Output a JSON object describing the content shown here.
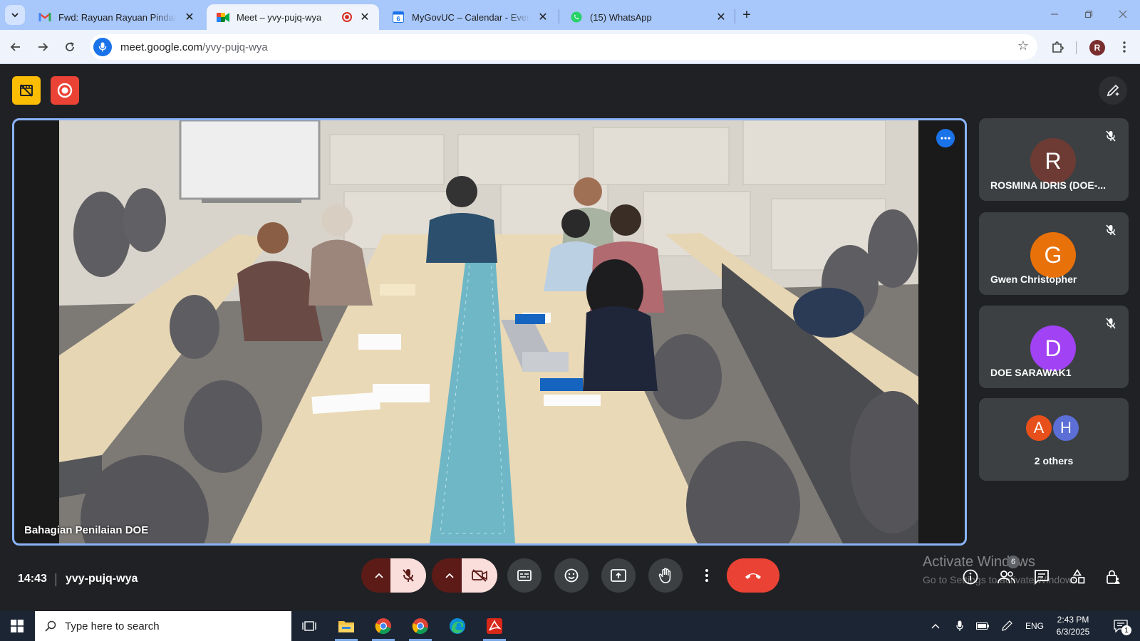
{
  "browser": {
    "tabs": [
      {
        "label": "Fwd: Rayuan Rayuan Pindaan ke",
        "icon": "gmail-icon"
      },
      {
        "label": "Meet – yvy-pujq-wya",
        "icon": "meet-icon",
        "active": true,
        "recording": true
      },
      {
        "label": "MyGovUC – Calendar - Event de",
        "icon": "calendar-icon"
      },
      {
        "label": "(15) WhatsApp",
        "icon": "whatsapp-icon"
      }
    ],
    "url_host": "meet.google.com",
    "url_path": "/yvy-pujq-wya",
    "profile_initial": "R"
  },
  "meet": {
    "main_tile_name": "Bahagian Penilaian DOE",
    "participants": [
      {
        "initial": "R",
        "name": "ROSMINA IDRIS (DOE-...",
        "color": "#6d3b34"
      },
      {
        "initial": "G",
        "name": "Gwen Christopher",
        "color": "#e8710a"
      },
      {
        "initial": "D",
        "name": "DOE SARAWAK1",
        "color": "#a142f4"
      }
    ],
    "others": {
      "initials": [
        "A",
        "H"
      ],
      "colors": [
        "#e8501b",
        "#5b6fd6"
      ],
      "label": "2 others"
    },
    "time": "14:43",
    "meeting_code": "yvy-pujq-wya",
    "people_count": "6",
    "accent": "#8ab4f8",
    "hangup_color": "#ea4335"
  },
  "watermark": {
    "line1": "Activate Windows",
    "line2": "Go to Settings to activate Windows."
  },
  "taskbar": {
    "search_placeholder": "Type here to search",
    "lang": "ENG",
    "time": "2:43 PM",
    "date": "6/3/2025",
    "notifications": "1"
  }
}
